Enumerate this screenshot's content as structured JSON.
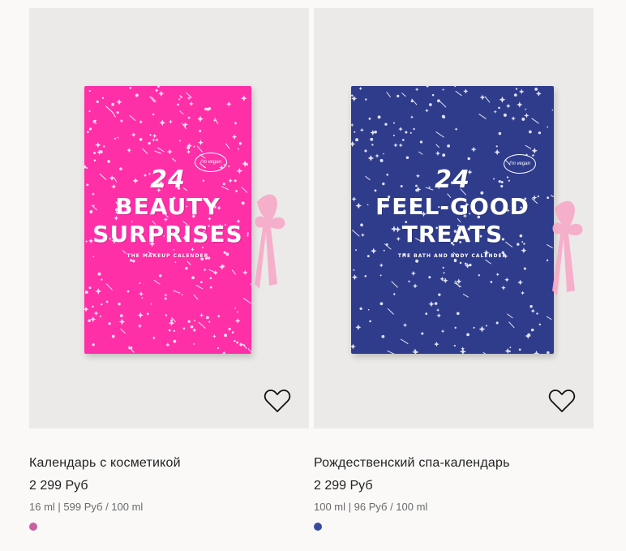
{
  "products": [
    {
      "name": "Календарь с косметикой",
      "price": "2 299 Руб",
      "unit_price": "16 ml | 599 Руб / 100 ml",
      "swatch_color": "#c7619f",
      "box_color": "#ff2fa8",
      "box_lines": [
        "24",
        "BEAUTY",
        "SURPRISES"
      ],
      "box_sub": "THE MAKEUP CALENDER",
      "box_badge": "I'm vegan",
      "ribbon_color": "#f7a9c6"
    },
    {
      "name": "Рождественский спа-календарь",
      "price": "2 299 Руб",
      "unit_price": "100 ml | 96 Руб / 100 ml",
      "swatch_color": "#3a4aa0",
      "box_color": "#2f3c8c",
      "box_lines": [
        "24",
        "FEEL-GOOD",
        "TREATS"
      ],
      "box_sub": "THE BATH AND BODY CALENDER",
      "box_badge": "I'm vegan",
      "ribbon_color": "#f7a9c6"
    }
  ],
  "icons": {
    "favorite": "heart-outline-icon"
  }
}
